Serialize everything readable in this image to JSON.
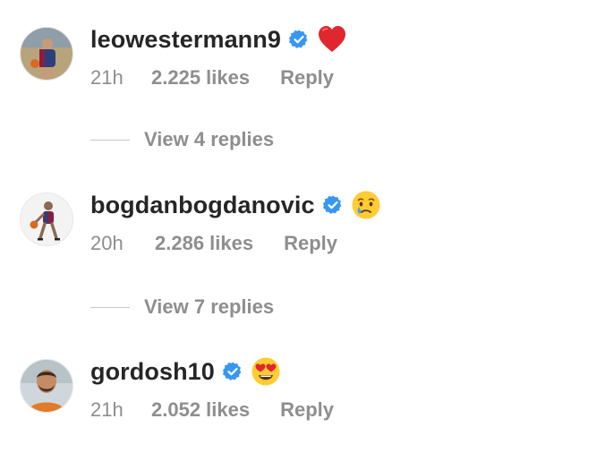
{
  "comments": [
    {
      "username": "leowestermann9",
      "verified": true,
      "emoji": "red-heart",
      "time": "21h",
      "likes": "2.225 likes",
      "reply_label": "Reply",
      "view_replies": "View 4 replies"
    },
    {
      "username": "bogdanbogdanovic",
      "verified": true,
      "emoji": "crying-face",
      "time": "20h",
      "likes": "2.286 likes",
      "reply_label": "Reply",
      "view_replies": "View 7 replies"
    },
    {
      "username": "gordosh10",
      "verified": true,
      "emoji": "heart-eyes-face",
      "time": "21h",
      "likes": "2.052 likes",
      "reply_label": "Reply"
    }
  ],
  "colors": {
    "verified_blue": "#3897f0",
    "meta_gray": "#8e8e8e",
    "text_dark": "#262626"
  }
}
